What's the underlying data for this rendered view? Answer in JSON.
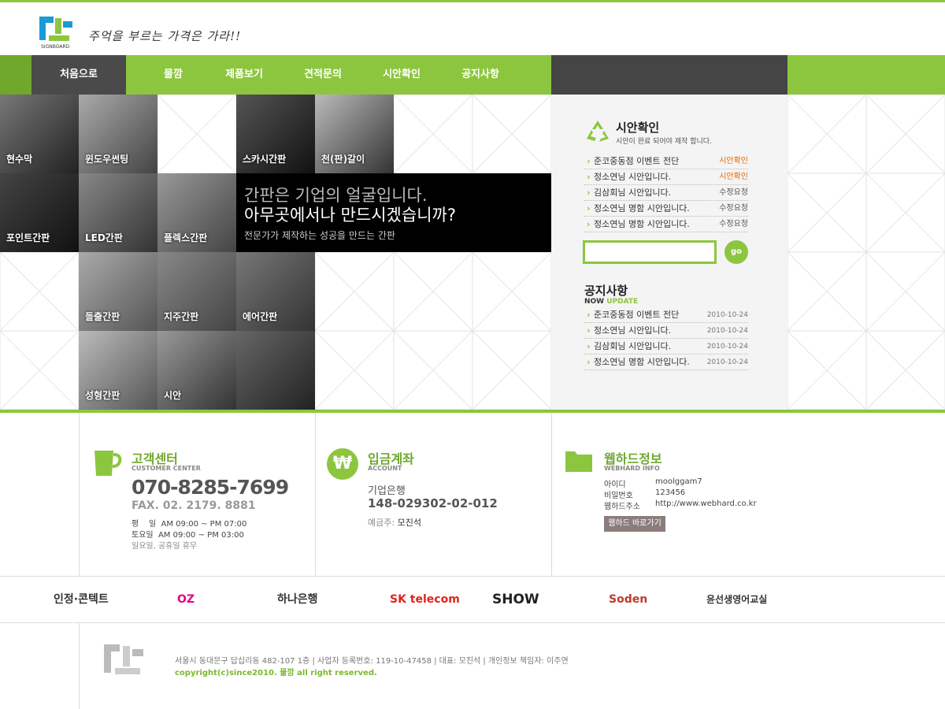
{
  "header": {
    "logo_text": "물깜",
    "logo_sub": "SIGNBOARD",
    "slogan": "주억을 부르는 가격은 가라!!"
  },
  "nav": {
    "home": "처음으로",
    "items": [
      "물깜",
      "제품보기",
      "견적문의",
      "시안확인",
      "공지사항"
    ]
  },
  "tiles": [
    "현수막",
    "윈도우썬팅",
    "스카시간판",
    "천(판)갈이",
    "포인트간판",
    "LED간판",
    "플렉스간판",
    "돌출간판",
    "지주간판",
    "에어간판",
    "성형간판",
    "시안"
  ],
  "banner": {
    "line1": "간판은 기업의 얼굴입니다.",
    "line2": "아무곳에서나 만드시겠습니까?",
    "line3": "전문가가 제작하는 성공을 만드는 간판"
  },
  "draft": {
    "title": "시안확인",
    "subtitle": "시안이 완료 되어야 제작 합니다.",
    "rows": [
      {
        "text": "준코중동점 이벤트 전단",
        "status": "시안확인",
        "hl": true
      },
      {
        "text": "정소연님 시안입니다.",
        "status": "시안확인",
        "hl": true
      },
      {
        "text": "김삼회님 시안입니다.",
        "status": "수정요청",
        "hl": false
      },
      {
        "text": "정소연님 명함 시안입니다.",
        "status": "수정요청",
        "hl": false
      },
      {
        "text": "정소연님 명함 시안입니다.",
        "status": "수정요청",
        "hl": false
      }
    ],
    "go": "go"
  },
  "notice": {
    "title": "공지사항",
    "sub_now": "NOW",
    "sub_update": "UPDATE",
    "rows": [
      {
        "text": "준코중동점 이벤트 전단",
        "date": "2010-10-24"
      },
      {
        "text": "정소연님 시안입니다.",
        "date": "2010-10-24"
      },
      {
        "text": "김삼회님 시안입니다.",
        "date": "2010-10-24"
      },
      {
        "text": "정소연님 명함 시안입니다.",
        "date": "2010-10-24"
      }
    ]
  },
  "customer": {
    "title": "고객센터",
    "en": "CUSTOMER CENTER",
    "phone": "070-8285-7699",
    "fax": "FAX. 02. 2179. 8881",
    "hours1": "평    일  AM 09:00 ~ PM 07:00",
    "hours2": "토요일  AM 09:00 ~ PM 03:00",
    "holiday": "일요일, 공휴일 휴무"
  },
  "account": {
    "title": "입금계좌",
    "en": "ACCOUNT",
    "bank": "기업은행",
    "number": "148-029302-02-012",
    "holder_label": "예금주:",
    "holder": "모진석"
  },
  "webhard": {
    "title": "웹하드정보",
    "en": "WEBHARD INFO",
    "id_label": "아이디",
    "id": "moolggam7",
    "pw_label": "비밀번호",
    "pw": "123456",
    "url_label": "웹하드주소",
    "url": "http://www.webhard.co.kr",
    "button": "웹하드 바로가기"
  },
  "partners": [
    "인정·콘텍트",
    "OZ",
    "하나은행",
    "SK telecom",
    "SHOW",
    "Soden",
    "윤선생영어교실"
  ],
  "footer": {
    "address": "서울시 동대문구 답십리동 482-107 1층   |  사업자 등록번호: 119-10-47458   |  대표: 모진석   |  개인정보 책임자: 이주연",
    "copyright": "copyright(c)since2010. 물깜 all right reserved."
  },
  "colors": {
    "accent": "#8cc63f",
    "dark": "#454545",
    "highlight": "#e36c09"
  }
}
